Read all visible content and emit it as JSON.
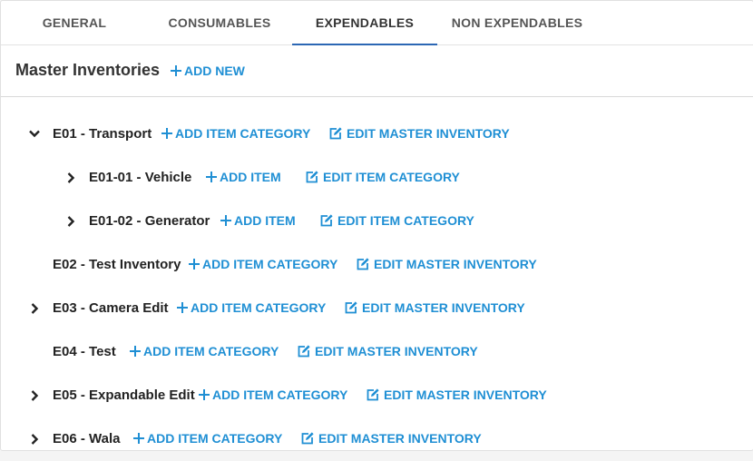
{
  "tabs": [
    {
      "label": "GENERAL",
      "active": false
    },
    {
      "label": "CONSUMABLES",
      "active": false
    },
    {
      "label": "EXPENDABLES",
      "active": true
    },
    {
      "label": "NON EXPENDABLES",
      "active": false
    }
  ],
  "header": {
    "title": "Master Inventories",
    "add_new_label": "ADD NEW"
  },
  "tree": [
    {
      "label": "E01 - Transport",
      "add_label": "ADD ITEM CATEGORY",
      "edit_label": "EDIT MASTER INVENTORY",
      "toggle": "expanded"
    },
    {
      "label": "E01-01 - Vehicle",
      "add_label": "ADD ITEM",
      "edit_label": "EDIT ITEM CATEGORY",
      "toggle": "collapsed"
    },
    {
      "label": "E01-02 - Generator",
      "add_label": "ADD ITEM",
      "edit_label": "EDIT ITEM CATEGORY",
      "toggle": "collapsed"
    },
    {
      "label": "E02 - Test Inventory",
      "add_label": "ADD ITEM CATEGORY",
      "edit_label": "EDIT MASTER INVENTORY",
      "toggle": "none"
    },
    {
      "label": "E03 - Camera Edit",
      "add_label": "ADD ITEM CATEGORY",
      "edit_label": "EDIT MASTER INVENTORY",
      "toggle": "collapsed"
    },
    {
      "label": "E04 - Test",
      "add_label": "ADD ITEM CATEGORY",
      "edit_label": "EDIT MASTER INVENTORY",
      "toggle": "none"
    },
    {
      "label": "E05 - Expandable Edit",
      "add_label": "ADD ITEM CATEGORY",
      "edit_label": "EDIT MASTER INVENTORY",
      "toggle": "collapsed"
    },
    {
      "label": "E06 - Wala",
      "add_label": "ADD ITEM CATEGORY",
      "edit_label": "EDIT MASTER INVENTORY",
      "toggle": "collapsed"
    }
  ],
  "colors": {
    "accent": "#1f8fd4",
    "tab_indicator": "#2c67b4"
  },
  "icons": {
    "add": "plus-icon",
    "edit": "edit-icon",
    "expanded": "chevron-down-icon",
    "collapsed": "chevron-right-icon"
  }
}
